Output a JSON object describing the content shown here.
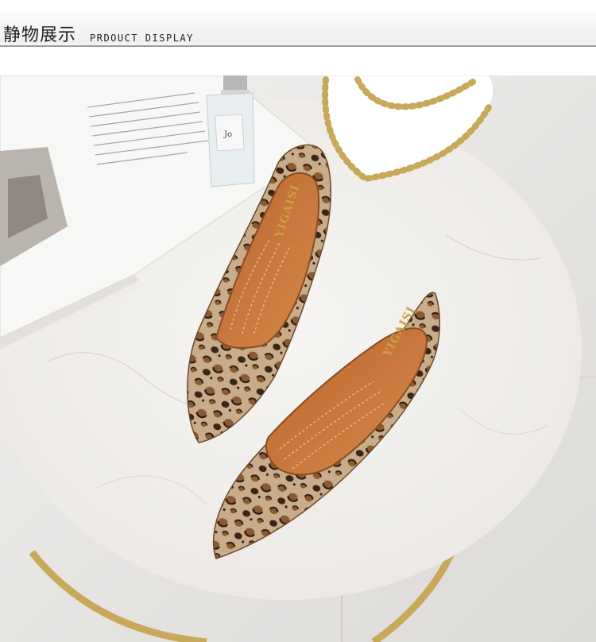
{
  "section": {
    "title_zh": "静物展示",
    "title_en": "PRDOUCT DISPLAY"
  },
  "photo": {
    "brand_on_insole": "YIGAISI",
    "perfume_label": "Jo",
    "colors": {
      "background": "#eceae7",
      "table": "#f3f1ee",
      "leopard_base": "#c9ac8a",
      "spot_dark": "#3a2517",
      "spot_brown": "#8b5a33",
      "insole": "#c9783d",
      "gold": "#c8a85a"
    }
  }
}
